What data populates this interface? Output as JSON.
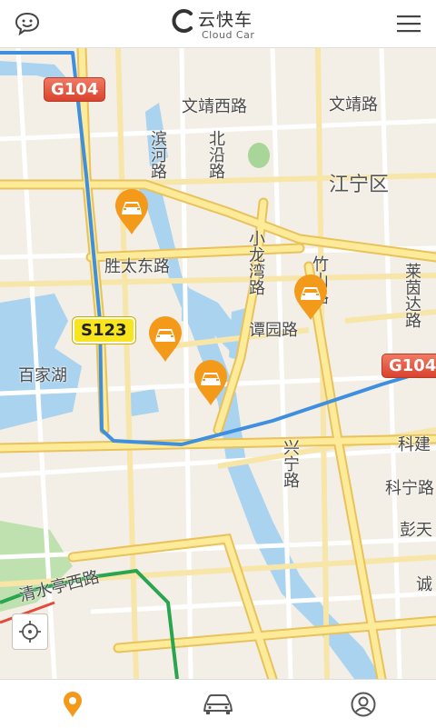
{
  "app": {
    "logo_cn": "云快车",
    "logo_en": "Cloud Car",
    "accent": "#f39a1b"
  },
  "header": {
    "left_icon": "chat-smile-icon",
    "right_icon": "menu-icon"
  },
  "map": {
    "labels": {
      "wenjing_west": "文靖西路",
      "wenjing": "文靖路",
      "binhe": "滨河路",
      "beiyan": "北沿路",
      "jiangning": "江宁区",
      "shengtai_east": "胜太东路",
      "xiaolongwan": "小龙湾路",
      "zhuyan": "竹山路",
      "laiyin": "莱茵达路",
      "tanyuan": "谭园路",
      "baijia_lake": "百家湖",
      "xingning": "兴宁路",
      "kejian": "科建",
      "kening": "科宁路",
      "pengtian": "彭天",
      "qingshuiting_west": "清水亭西路",
      "cheng": "诚"
    },
    "shields": {
      "g104_top": "G104",
      "s123": "S123",
      "g104_right": "G104"
    },
    "car_markers": [
      {
        "label": "car-marker-1"
      },
      {
        "label": "car-marker-2"
      },
      {
        "label": "car-marker-3"
      },
      {
        "label": "car-marker-4"
      }
    ]
  },
  "tabbar": {
    "items": [
      {
        "icon": "location-pin-icon",
        "active": true
      },
      {
        "icon": "car-icon",
        "active": false
      },
      {
        "icon": "user-icon",
        "active": false
      }
    ]
  }
}
